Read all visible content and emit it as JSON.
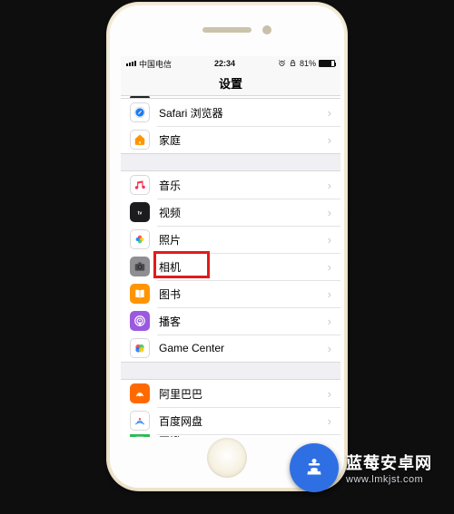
{
  "status": {
    "carrier": "中国电信",
    "time": "22:34",
    "alarm_icon": "alarm-icon",
    "lock_icon": "lock-icon",
    "battery_pct": "81%"
  },
  "nav": {
    "title": "设置"
  },
  "groups": [
    {
      "kind": "sliver"
    },
    {
      "items": [
        {
          "id": "safari",
          "label": "Safari 浏览器",
          "icon": "safari-icon",
          "bg": "#ffffff",
          "stroke": "#1a7cf0"
        },
        {
          "id": "home",
          "label": "家庭",
          "icon": "home-icon",
          "bg": "#ffffff",
          "stroke": "#ff9500"
        }
      ]
    },
    {
      "items": [
        {
          "id": "music",
          "label": "音乐",
          "icon": "music-icon",
          "bg": "#ffffff",
          "stroke": "#ff2d55"
        },
        {
          "id": "tv",
          "label": "视频",
          "icon": "tv-icon",
          "bg": "#1c1c1e",
          "stroke": "#ffffff"
        },
        {
          "id": "photos",
          "label": "照片",
          "icon": "photos-icon",
          "bg": "#ffffff",
          "stroke": ""
        },
        {
          "id": "camera",
          "label": "相机",
          "icon": "camera-icon",
          "bg": "#8e8e93",
          "stroke": "#ffffff",
          "highlight": true
        },
        {
          "id": "books",
          "label": "图书",
          "icon": "books-icon",
          "bg": "#ff9500",
          "stroke": "#ffffff"
        },
        {
          "id": "podcasts",
          "label": "播客",
          "icon": "podcasts-icon",
          "bg": "#9b59e0",
          "stroke": "#ffffff"
        },
        {
          "id": "gamecenter",
          "label": "Game Center",
          "icon": "gamecenter-icon",
          "bg": "#ffffff",
          "stroke": ""
        }
      ]
    },
    {
      "items": [
        {
          "id": "alibaba",
          "label": "阿里巴巴",
          "icon": "alibaba-icon",
          "bg": "#ff6a00",
          "stroke": "#ffffff"
        },
        {
          "id": "baidu",
          "label": "百度网盘",
          "icon": "baidu-icon",
          "bg": "#ffffff",
          "stroke": "#2f86ff"
        },
        {
          "id": "cutoff",
          "label": "豆瓣",
          "icon": "generic-icon",
          "bg": "#2dbb55",
          "stroke": "#ffffff",
          "cut": true
        }
      ]
    }
  ],
  "watermark": {
    "title": "蓝莓安卓网",
    "url": "www.lmkjst.com"
  }
}
